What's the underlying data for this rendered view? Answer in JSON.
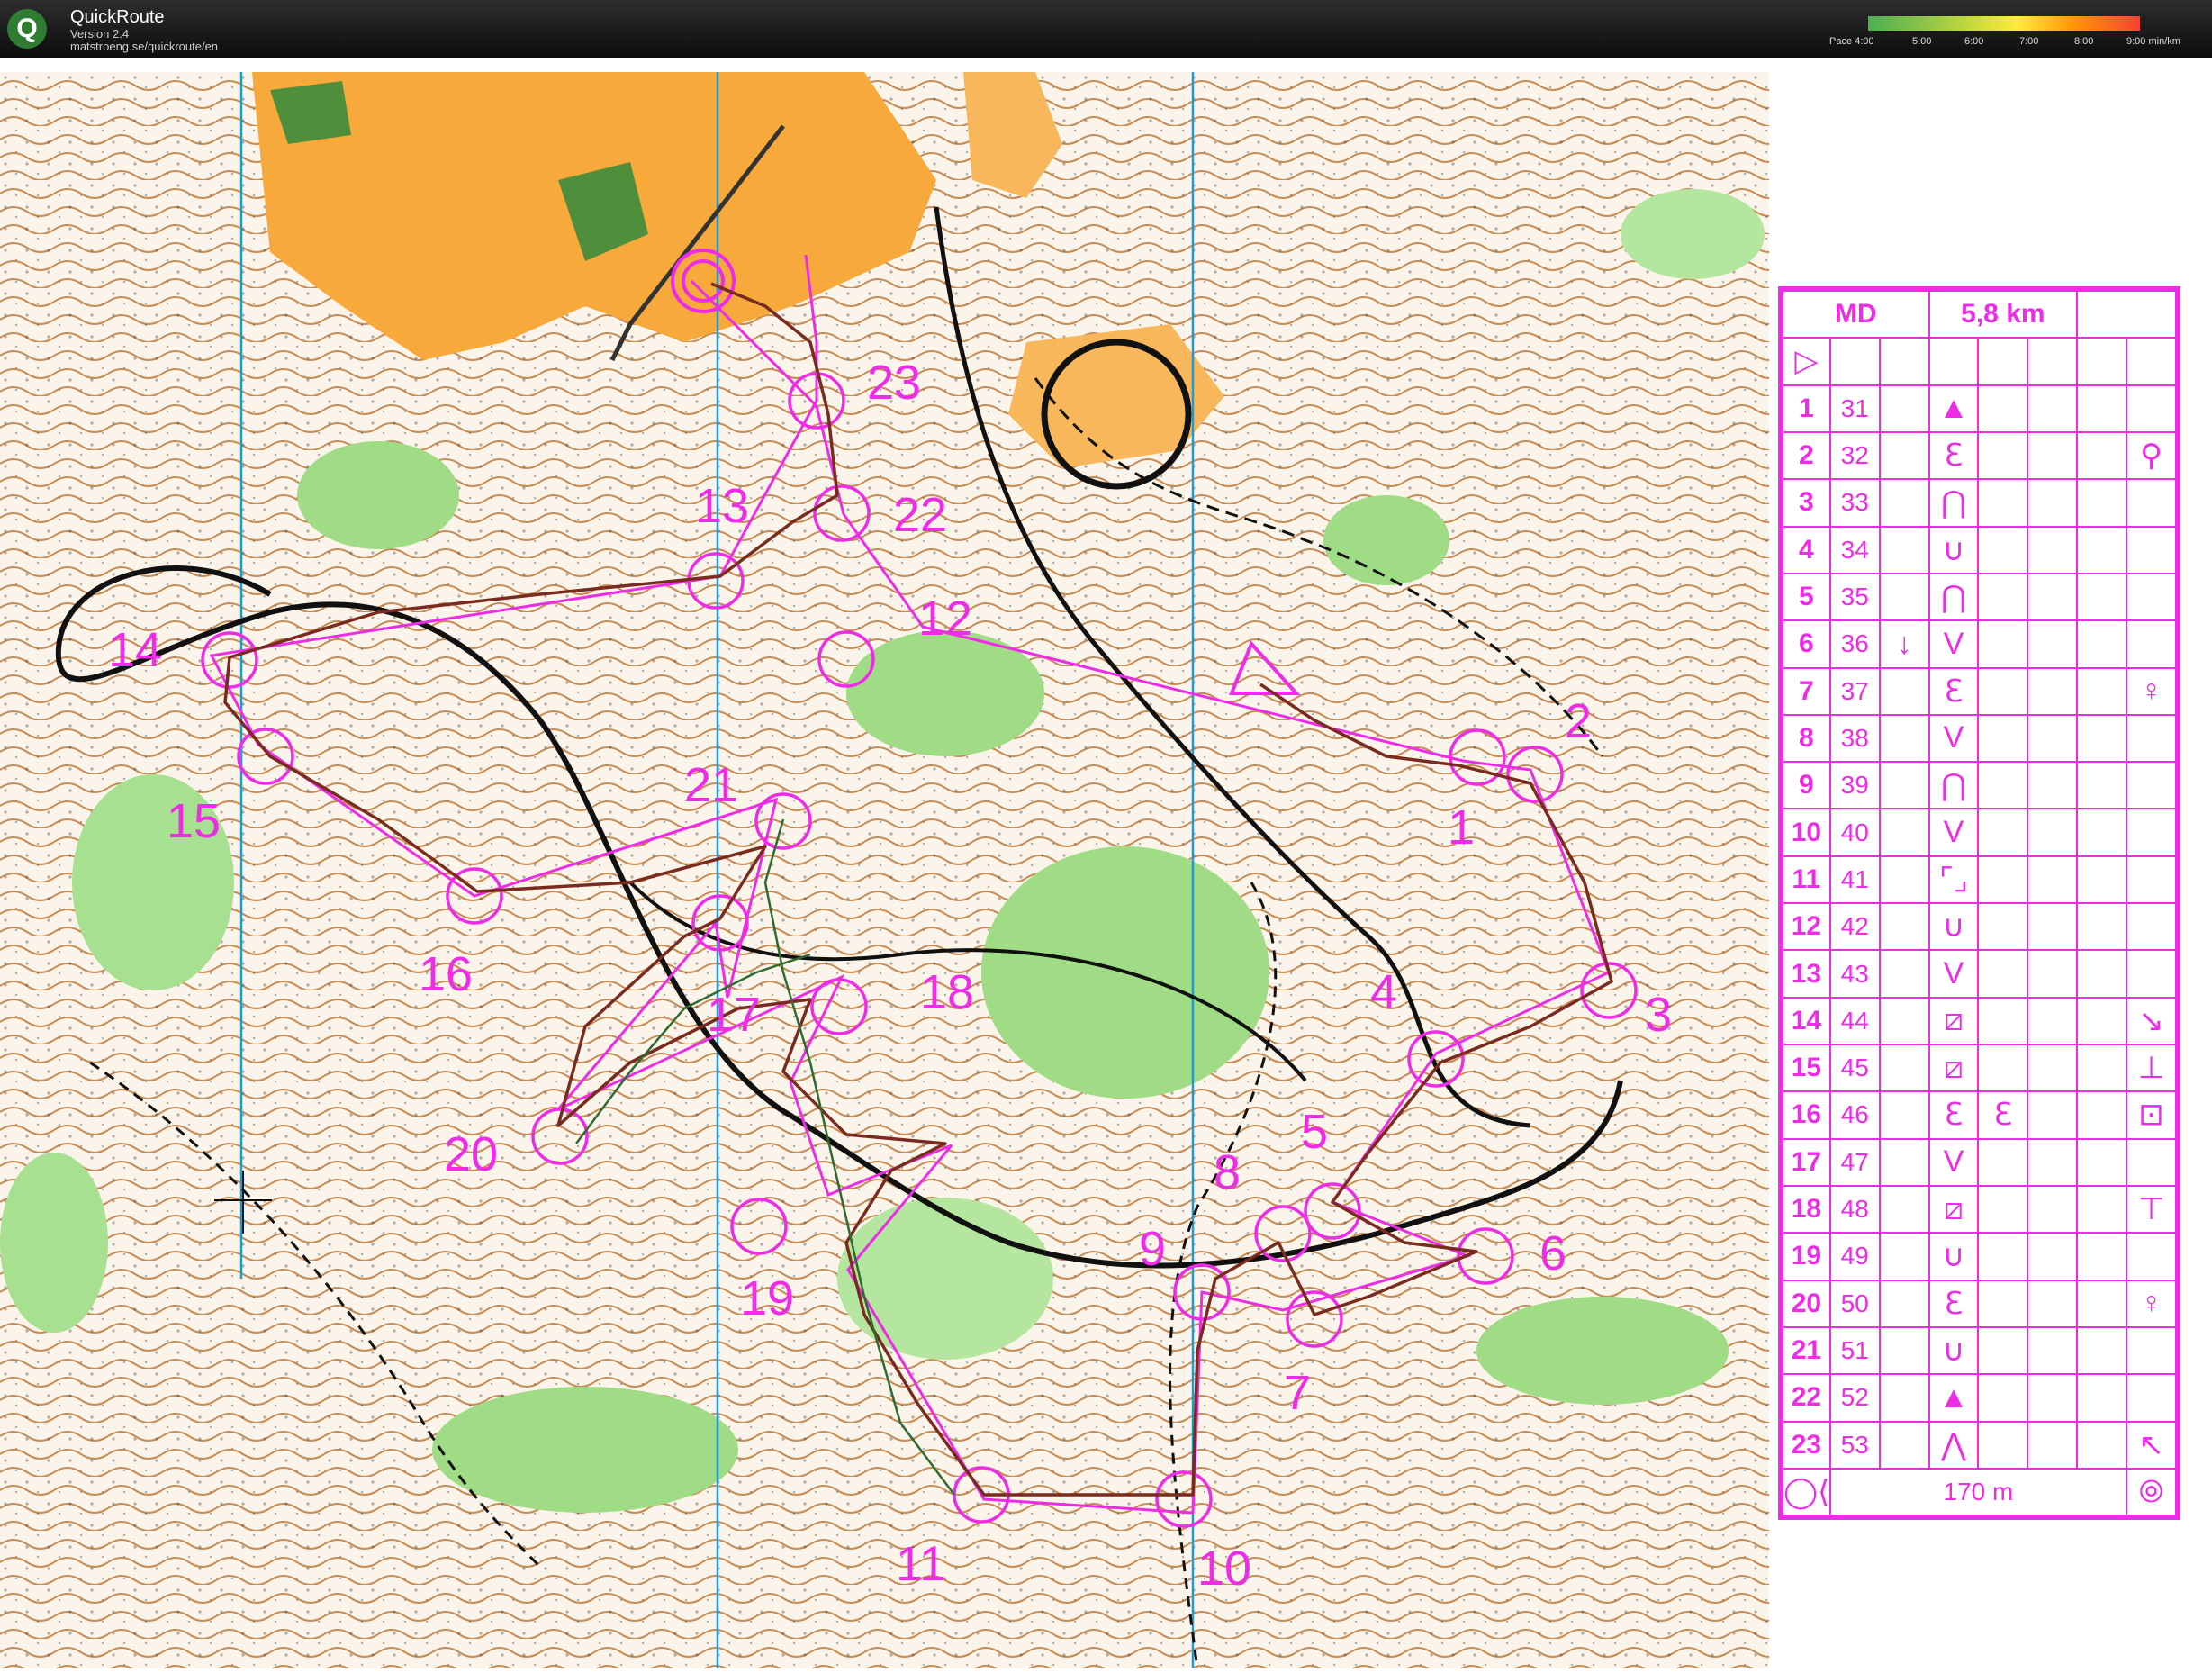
{
  "app": {
    "logo_letter": "Q",
    "name": "QuickRoute",
    "version": "Version 2.4",
    "url": "matstroeng.se/quickroute/en",
    "pace_scale": [
      "Pace 4:00",
      "5:00",
      "6:00",
      "7:00",
      "8:00",
      "9:00  min/km"
    ]
  },
  "map": {
    "control_labels": [
      "1",
      "2",
      "3",
      "4",
      "5",
      "6",
      "7",
      "8",
      "9",
      "10",
      "11",
      "12",
      "13",
      "14",
      "15",
      "16",
      "17",
      "18",
      "19",
      "20",
      "21",
      "22",
      "23"
    ]
  },
  "description_sheet": {
    "header": {
      "class": "MD",
      "length": "5,8 km"
    },
    "start_symbol": "▷",
    "controls": [
      {
        "num": "1",
        "code": "31",
        "c": "",
        "d": "▲",
        "e": "",
        "f": ""
      },
      {
        "num": "2",
        "code": "32",
        "c": "",
        "d": "ℇ",
        "e": "",
        "f": "⚲"
      },
      {
        "num": "3",
        "code": "33",
        "c": "",
        "d": "⋂",
        "e": "",
        "f": ""
      },
      {
        "num": "4",
        "code": "34",
        "c": "",
        "d": "∪",
        "e": "",
        "f": ""
      },
      {
        "num": "5",
        "code": "35",
        "c": "",
        "d": "⋂",
        "e": "",
        "f": ""
      },
      {
        "num": "6",
        "code": "36",
        "c": "↓",
        "d": "V",
        "e": "",
        "f": ""
      },
      {
        "num": "7",
        "code": "37",
        "c": "",
        "d": "ℇ",
        "e": "",
        "f": "♀"
      },
      {
        "num": "8",
        "code": "38",
        "c": "",
        "d": "V",
        "e": "",
        "f": ""
      },
      {
        "num": "9",
        "code": "39",
        "c": "",
        "d": "⋂",
        "e": "",
        "f": ""
      },
      {
        "num": "10",
        "code": "40",
        "c": "",
        "d": "V",
        "e": "",
        "f": ""
      },
      {
        "num": "11",
        "code": "41",
        "c": "",
        "d": "⌜⌟",
        "e": "",
        "f": ""
      },
      {
        "num": "12",
        "code": "42",
        "c": "",
        "d": "∪",
        "e": "",
        "f": ""
      },
      {
        "num": "13",
        "code": "43",
        "c": "",
        "d": "V",
        "e": "",
        "f": ""
      },
      {
        "num": "14",
        "code": "44",
        "c": "",
        "d": "⧄",
        "e": "",
        "f": "↘"
      },
      {
        "num": "15",
        "code": "45",
        "c": "",
        "d": "⧄",
        "e": "",
        "f": "⊥"
      },
      {
        "num": "16",
        "code": "46",
        "c": "",
        "d": "ℇ",
        "e": "ℇ",
        "f": "⊡"
      },
      {
        "num": "17",
        "code": "47",
        "c": "",
        "d": "V",
        "e": "",
        "f": ""
      },
      {
        "num": "18",
        "code": "48",
        "c": "",
        "d": "⧄",
        "e": "",
        "f": "⊤"
      },
      {
        "num": "19",
        "code": "49",
        "c": "",
        "d": "∪",
        "e": "",
        "f": ""
      },
      {
        "num": "20",
        "code": "50",
        "c": "",
        "d": "ℇ",
        "e": "",
        "f": "♀"
      },
      {
        "num": "21",
        "code": "51",
        "c": "",
        "d": "∪",
        "e": "",
        "f": ""
      },
      {
        "num": "22",
        "code": "52",
        "c": "",
        "d": "▲",
        "e": "",
        "f": ""
      },
      {
        "num": "23",
        "code": "53",
        "c": "",
        "d": "⋀",
        "e": "",
        "f": "↖"
      }
    ],
    "finish_distance": "170 m"
  },
  "colors": {
    "course": "#ee2ce8",
    "terrain_open": "#f7a93b",
    "terrain_green": "#9fdc85",
    "contour": "#b5651d",
    "route": "#7a2b1f"
  }
}
